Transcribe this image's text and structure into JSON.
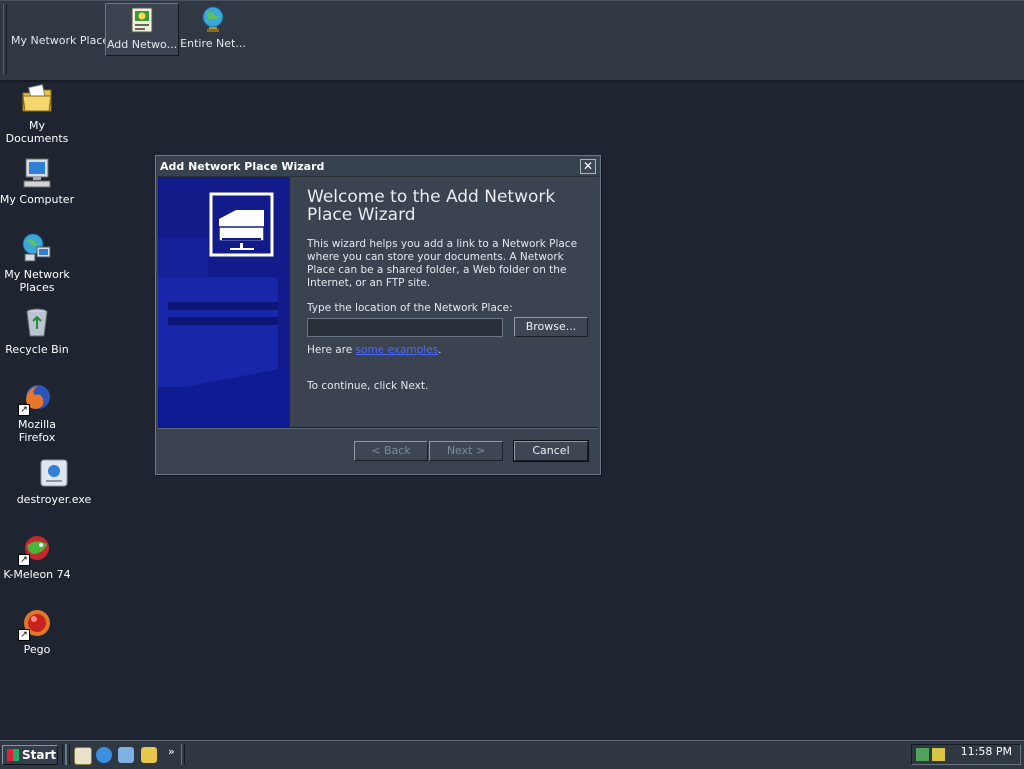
{
  "toolbar": {
    "address_label": "My Network Places",
    "items": [
      {
        "label": "Add Netwo...",
        "icon": "add-network-place-icon",
        "pressed": true
      },
      {
        "label": "Entire Net...",
        "icon": "globe-icon",
        "pressed": false
      }
    ]
  },
  "desktop": {
    "icons": [
      {
        "label": "My Documents",
        "icon": "documents-folder-icon"
      },
      {
        "label": "My Computer",
        "icon": "computer-icon"
      },
      {
        "label": "My Network Places",
        "icon": "network-places-icon"
      },
      {
        "label": "Recycle Bin",
        "icon": "recycle-bin-icon"
      },
      {
        "label": "Mozilla Firefox",
        "icon": "firefox-icon"
      },
      {
        "label": "destroyer.exe",
        "icon": "exe-app-icon"
      },
      {
        "label": "K-Meleon 74",
        "icon": "k-meleon-icon"
      },
      {
        "label": "Pego",
        "icon": "pego-icon"
      }
    ]
  },
  "dialog": {
    "title": "Add Network Place Wizard",
    "close_glyph": "✕",
    "heading": "Welcome to the Add Network Place Wizard",
    "description": "This wizard helps you add a link to a Network Place where you can store your documents. A Network Place can be a shared folder, a Web folder on the Internet, or an FTP site.",
    "location_label": "Type the location of the Network Place:",
    "location_value": "",
    "browse_label": "Browse...",
    "examples_prefix": "Here are ",
    "examples_link": "some examples",
    "examples_suffix": ".",
    "continue_text": "To continue, click Next.",
    "back_label": "< Back",
    "next_label": "Next >",
    "cancel_label": "Cancel"
  },
  "taskbar": {
    "start_label": "Start",
    "quick_launch": [
      "show-desktop-icon",
      "internet-explorer-icon",
      "network-icon",
      "explorer-icon"
    ],
    "chevron": "»",
    "tray_icons": [
      "network-tray-icon",
      "security-tray-icon"
    ],
    "clock": "11:58 PM"
  },
  "colors": {
    "desktop_bg": "#1e2530",
    "panel_bg": "#3b4350",
    "wizard_art": "#111c8a",
    "link": "#4b68ff"
  }
}
